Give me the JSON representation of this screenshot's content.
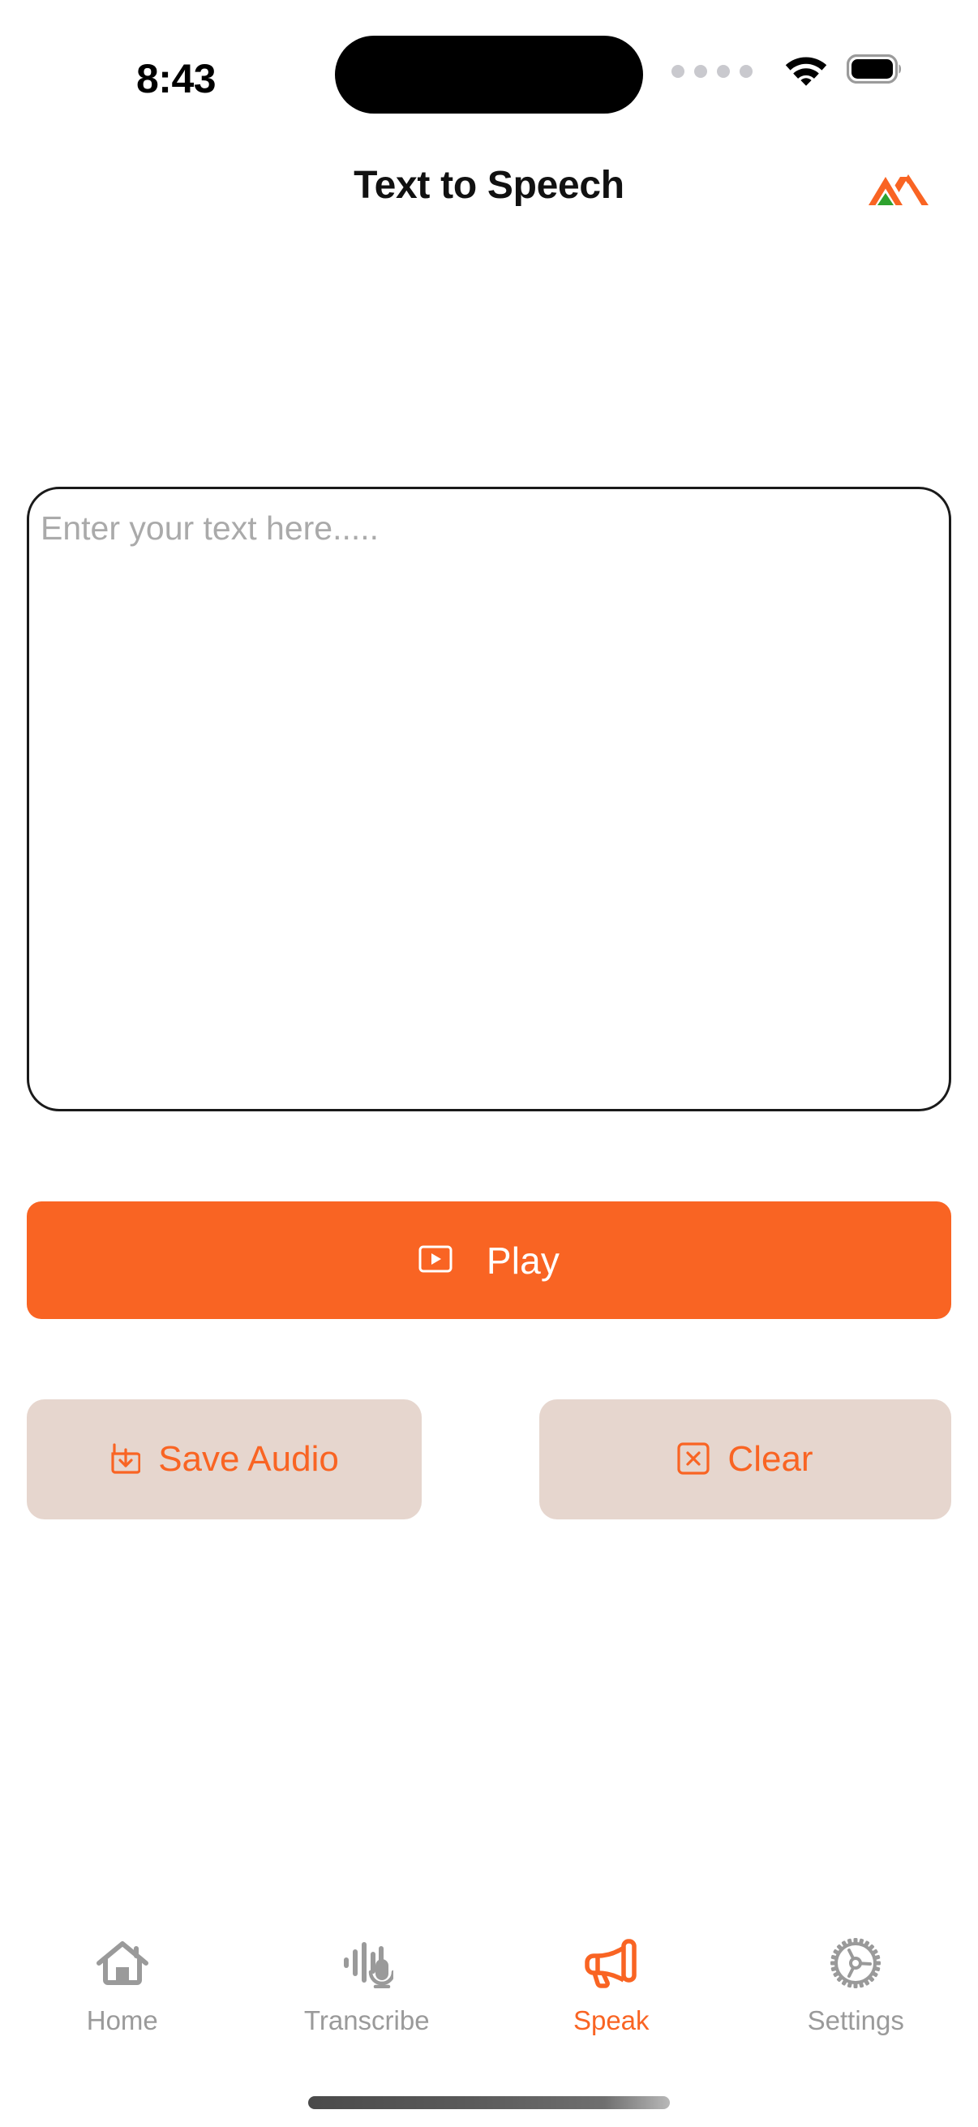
{
  "status_bar": {
    "time": "8:43",
    "signal_icon": "signal-dots-icon",
    "wifi_icon": "wifi-icon",
    "battery_icon": "battery-full-icon"
  },
  "header": {
    "title": "Text to Speech",
    "logo_icon": "brand-mountain-logo-icon",
    "logo_color_primary": "#F96423",
    "logo_color_secondary": "#2EA22E"
  },
  "text_input": {
    "value": "",
    "placeholder": "Enter your text here....."
  },
  "actions": {
    "play": {
      "label": "Play",
      "icon": "play-box-icon",
      "background": "#F96423",
      "text_color": "#FFFFFF"
    },
    "save_audio": {
      "label": "Save Audio",
      "icon": "download-tray-icon",
      "background": "#E6D6CE",
      "text_color": "#F96423"
    },
    "clear": {
      "label": "Clear",
      "icon": "x-box-icon",
      "background": "#E6D6CE",
      "text_color": "#F96423"
    }
  },
  "tab_bar": {
    "active_index": 2,
    "active_color": "#F96423",
    "inactive_color": "#9A9A9A",
    "items": [
      {
        "label": "Home",
        "icon": "home-icon"
      },
      {
        "label": "Transcribe",
        "icon": "waveform-microphone-icon"
      },
      {
        "label": "Speak",
        "icon": "megaphone-icon"
      },
      {
        "label": "Settings",
        "icon": "gear-icon"
      }
    ]
  }
}
